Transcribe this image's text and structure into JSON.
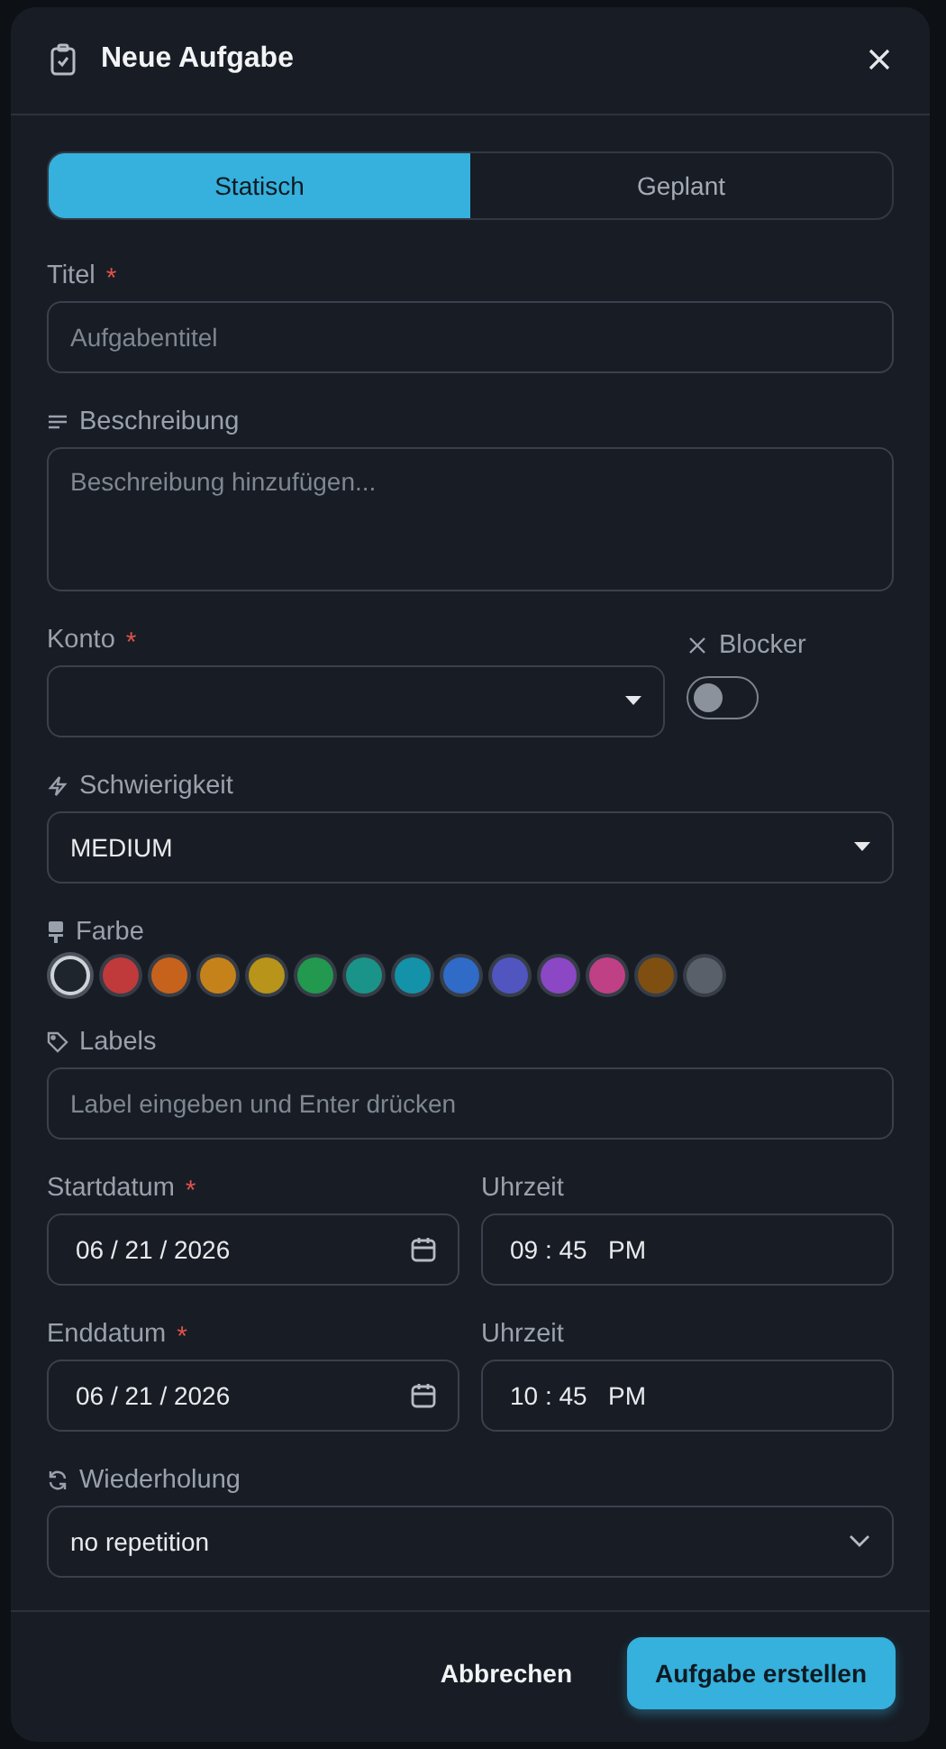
{
  "dialog": {
    "title": "Neue Aufgabe"
  },
  "tabs": [
    {
      "label": "Statisch",
      "selected": true
    },
    {
      "label": "Geplant",
      "selected": false
    }
  ],
  "title_field": {
    "label": "Titel",
    "required_mark": "*",
    "placeholder": "Aufgabentitel"
  },
  "description_field": {
    "label": "Beschreibung",
    "placeholder": "Beschreibung hinzufügen..."
  },
  "account_field": {
    "label": "Konto",
    "required_mark": "*"
  },
  "blocker": {
    "label": "Blocker",
    "on": false
  },
  "difficulty_field": {
    "label": "Schwierigkeit",
    "value": "MEDIUM"
  },
  "color_field": {
    "label": "Farbe",
    "swatches": [
      {
        "color": "#1f252d",
        "selected": true
      },
      {
        "color": "#c0393b",
        "selected": false
      },
      {
        "color": "#c7621c",
        "selected": false
      },
      {
        "color": "#c6821a",
        "selected": false
      },
      {
        "color": "#b8941a",
        "selected": false
      },
      {
        "color": "#22994f",
        "selected": false
      },
      {
        "color": "#1a9488",
        "selected": false
      },
      {
        "color": "#1492aa",
        "selected": false
      },
      {
        "color": "#2f6bc7",
        "selected": false
      },
      {
        "color": "#5155c0",
        "selected": false
      },
      {
        "color": "#8b47c4",
        "selected": false
      },
      {
        "color": "#c04086",
        "selected": false
      },
      {
        "color": "#7f4f12",
        "selected": false
      },
      {
        "color": "#5a606a",
        "selected": false
      }
    ]
  },
  "labels_field": {
    "label": "Labels",
    "placeholder": "Label eingeben und Enter drücken"
  },
  "start": {
    "date_label": "Startdatum",
    "required_mark": "*",
    "date": "06 / 21 / 2026",
    "time_label": "Uhrzeit",
    "time": "09 : 45   PM"
  },
  "end": {
    "date_label": "Enddatum",
    "required_mark": "*",
    "date": "06 / 21 / 2026",
    "time_label": "Uhrzeit",
    "time": "10 : 45   PM"
  },
  "repeat_field": {
    "label": "Wiederholung",
    "value": "no repetition"
  },
  "buttons": {
    "cancel": "Abbrechen",
    "submit": "Aufgabe erstellen"
  }
}
